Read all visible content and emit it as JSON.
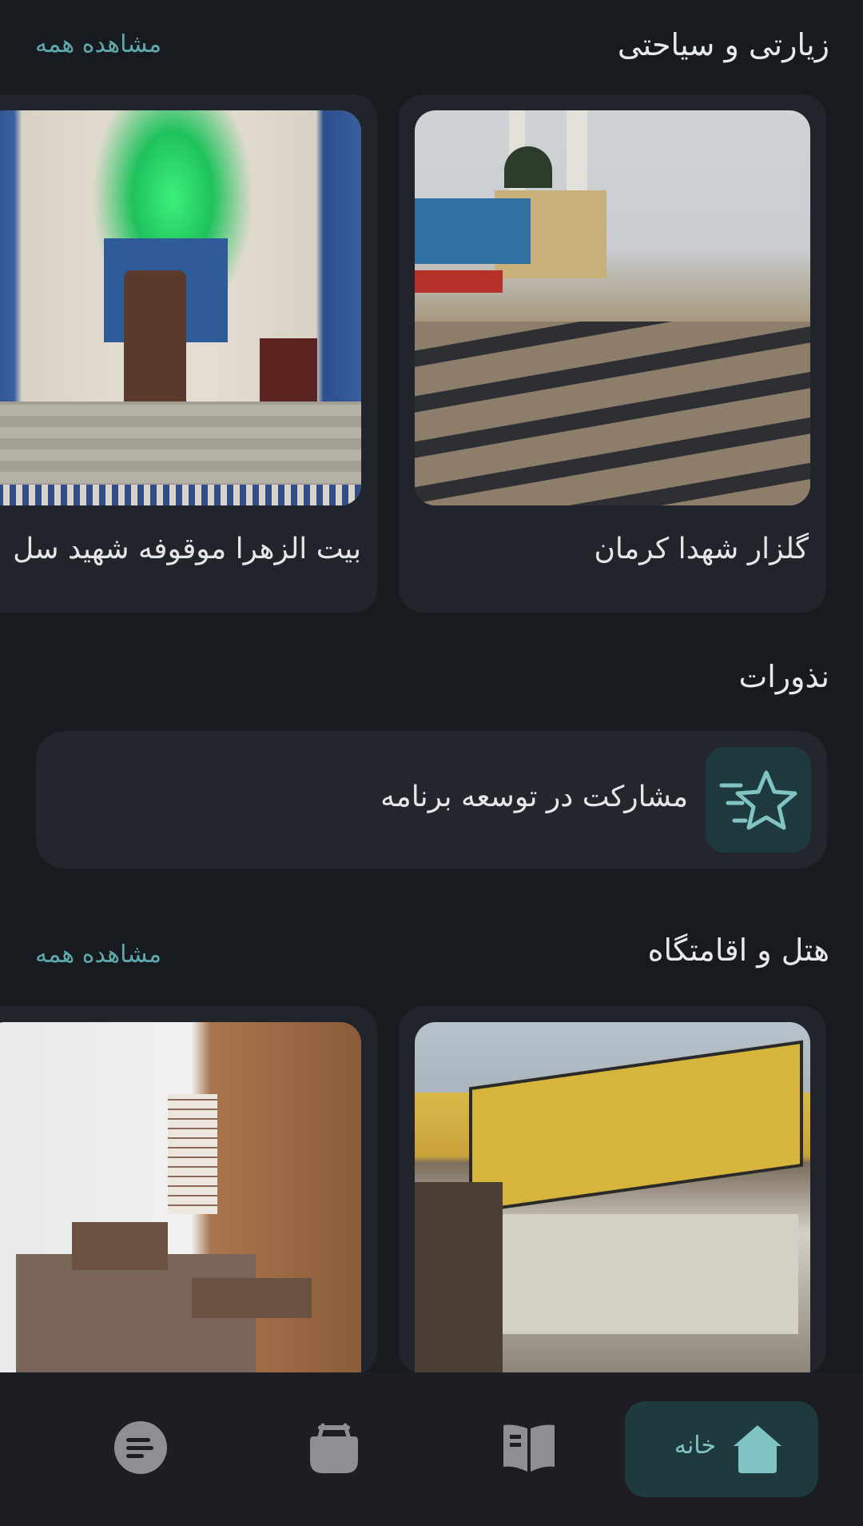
{
  "sections": {
    "pilgrimage": {
      "title": "زیارتی و سیاحتی",
      "see_all": "مشاهده همه",
      "cards": [
        {
          "label": "گلزار شهدا کرمان"
        },
        {
          "label": "بیت الزهرا موقوفه شهید سل"
        }
      ]
    },
    "vows": {
      "title": "نذورات",
      "banner_label": "مشارکت در توسعه برنامه"
    },
    "hotels": {
      "title": "هتل و اقامتگاه",
      "see_all": "مشاهده همه"
    }
  },
  "bottom_nav": {
    "items": [
      {
        "label": "خانه",
        "icon": "home-icon",
        "active": true
      },
      {
        "icon": "book-icon"
      },
      {
        "icon": "bag-icon"
      },
      {
        "icon": "menu-icon"
      }
    ]
  },
  "colors": {
    "background": "#171a1f",
    "card": "#22242b",
    "accent": "#5fa9ad",
    "accent_bg": "#1f3a3f"
  }
}
